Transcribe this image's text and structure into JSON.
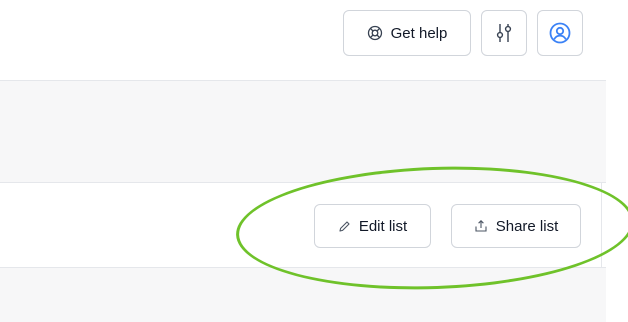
{
  "header": {
    "get_help_label": "Get help",
    "help_icon": "lifebuoy-icon",
    "settings_icon": "sliders-icon",
    "profile_icon": "user-circle-icon"
  },
  "toolbar": {
    "edit_label": "Edit list",
    "edit_icon": "pencil-icon",
    "share_label": "Share list",
    "share_icon": "share-upload-icon"
  },
  "annotation": {
    "color": "#6fc22a",
    "shape": "ellipse"
  },
  "colors": {
    "profile_accent": "#3b82f6",
    "border": "#d1d5db",
    "band_bg": "#f7f7f8"
  }
}
